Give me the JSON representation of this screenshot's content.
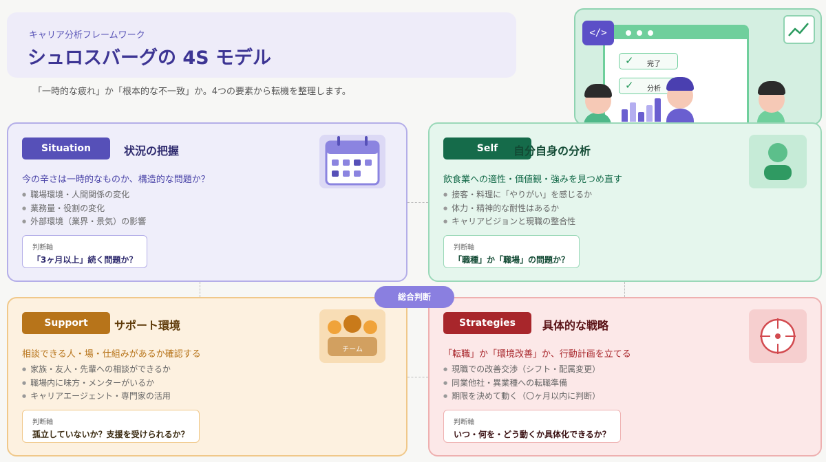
{
  "header": {
    "eyebrow": "キャリア分析フレームワーク",
    "title": "シュロスバーグの 4S モデル",
    "subtitle": "「一時的な疲れ」か「根本的な不一致」か。4つの要素から転機を整理します。"
  },
  "illustration": {
    "code_tag": "</>",
    "check_items": [
      "完了",
      "分析"
    ]
  },
  "center_badge": "総合判断",
  "judge_label": "判断軸",
  "cards": {
    "situation": {
      "tag": "Situation",
      "heading": "状況の把握",
      "lead": "今の辛さは一時的なものか、構造的な問題か？",
      "items": [
        "職場環境・人間関係の変化",
        "業務量・役割の変化",
        "外部環境（業界・景気）の影響"
      ],
      "judge": "「3ヶ月以上」続く問題か？",
      "icon": "calendar-icon"
    },
    "self": {
      "tag": "Self",
      "heading": "自分自身の分析",
      "lead": "飲食業への適性・価値観・強みを見つめ直す",
      "items": [
        "接客・料理に「やりがい」を感じるか",
        "体力・精神的な耐性はあるか",
        "キャリアビジョンと現職の整合性"
      ],
      "judge": "「職種」か「職場」の問題か？",
      "icon": "person-icon"
    },
    "support": {
      "tag": "Support",
      "heading": "サポート環境",
      "lead": "相談できる人・場・仕組みがあるか確認する",
      "items": [
        "家族・友人・先輩への相談ができるか",
        "職場内に味方・メンターがいるか",
        "キャリアエージェント・専門家の活用"
      ],
      "judge": "孤立していないか？支援を受けられるか？",
      "icon_label": "チーム",
      "icon": "team-icon"
    },
    "strategies": {
      "tag": "Strategies",
      "heading": "具体的な戦略",
      "lead": "「転職」か「環境改善」か、行動計画を立てる",
      "items": [
        "現職での改善交渉（シフト・配属変更）",
        "同業他社・異業種への転職準備",
        "期限を決めて動く（〇ヶ月以内に判断）"
      ],
      "judge": "いつ・何を・どう動くか具体化できるか？",
      "icon": "compass-icon"
    }
  },
  "colors": {
    "situation": "#5650b8",
    "self": "#156b4a",
    "support": "#b7741a",
    "strategies": "#a8262b"
  }
}
